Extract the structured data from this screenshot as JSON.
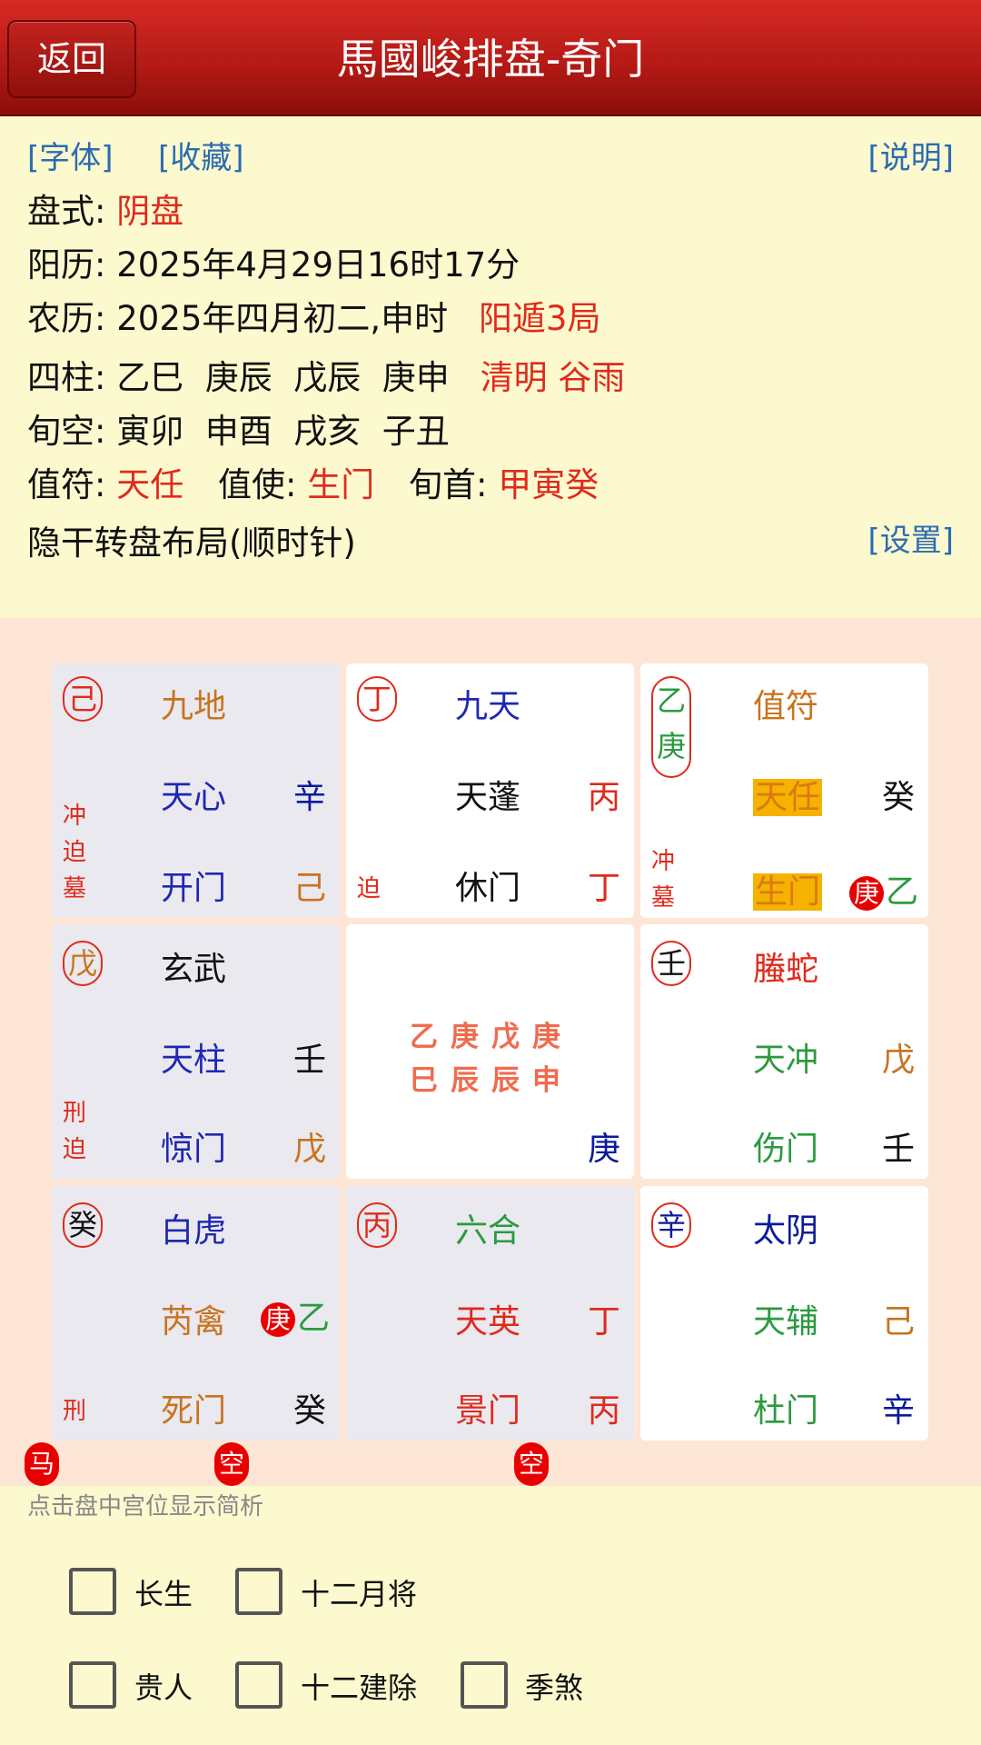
{
  "header": {
    "back_label": "返回",
    "title": "馬國峻排盘-奇门"
  },
  "links": {
    "font": "[字体]",
    "favorite": "[收藏]",
    "help": "[说明]",
    "settings": "[设置]"
  },
  "info": {
    "pan_label": "盘式:",
    "pan_value": "阴盘",
    "solar_label": "阳历:",
    "solar_value": "2025年4月29日16时17分",
    "lunar_label": "农历:",
    "lunar_value": "2025年四月初二,申时",
    "ju": "阳遁3局",
    "pillars_label": "四柱:",
    "pillars": "乙巳  庚辰  戊辰  庚申",
    "solar_terms": "清明 谷雨",
    "xunkong_label": "旬空:",
    "xunkong": "寅卯  申酉  戌亥  子丑",
    "zhifu_label": "值符:",
    "zhifu": "天任",
    "zhishi_label": "值使:",
    "zhishi": "生门",
    "xunshou_label": "旬首:",
    "xunshou": "甲寅癸",
    "layout_mode": "隐干转盘布局(顺时针)"
  },
  "palaces": {
    "p1": {
      "circle": "己",
      "god": "九地",
      "star": "天心",
      "star_stem": "辛",
      "door": "开门",
      "door_stem": "己",
      "side": [
        "冲",
        "迫",
        "墓"
      ]
    },
    "p2": {
      "circle": "丁",
      "god": "九天",
      "star": "天蓬",
      "star_stem": "丙",
      "door": "休门",
      "door_stem": "丁",
      "side": [
        "迫"
      ]
    },
    "p3": {
      "circle_a": "乙",
      "circle_b": "庚",
      "god": "值符",
      "star": "天任",
      "star_stem": "癸",
      "door": "生门",
      "door_dot": "庚",
      "door_stem": "乙",
      "side": [
        "冲",
        "墓"
      ]
    },
    "p4": {
      "circle": "戊",
      "god": "玄武",
      "star": "天柱",
      "star_stem": "壬",
      "door": "惊门",
      "door_stem": "戊",
      "side": [
        "刑",
        "迫"
      ]
    },
    "p5": {
      "row1": "乙庚戊庚",
      "row2": "巳辰辰申",
      "stem": "庚"
    },
    "p6": {
      "circle": "壬",
      "god": "螣蛇",
      "star": "天冲",
      "star_stem": "戊",
      "door": "伤门",
      "door_stem": "壬"
    },
    "p7": {
      "circle": "癸",
      "god": "白虎",
      "star": "芮禽",
      "star_dot": "庚",
      "star_stem": "乙",
      "door": "死门",
      "door_stem": "癸",
      "side": [
        "刑"
      ]
    },
    "p8": {
      "circle": "丙",
      "god": "六合",
      "star": "天英",
      "star_stem": "丁",
      "door": "景门",
      "door_stem": "丙"
    },
    "p9": {
      "circle": "辛",
      "god": "太阴",
      "star": "天辅",
      "star_stem": "己",
      "door": "杜门",
      "door_stem": "辛"
    }
  },
  "badges": {
    "horse": "马",
    "empty1": "空",
    "empty2": "空"
  },
  "hint": "点击盘中宫位显示简析",
  "options": {
    "changsheng": "长生",
    "yuejiang": "十二月将",
    "guiren": "贵人",
    "jianchu": "十二建除",
    "jisha": "季煞"
  }
}
